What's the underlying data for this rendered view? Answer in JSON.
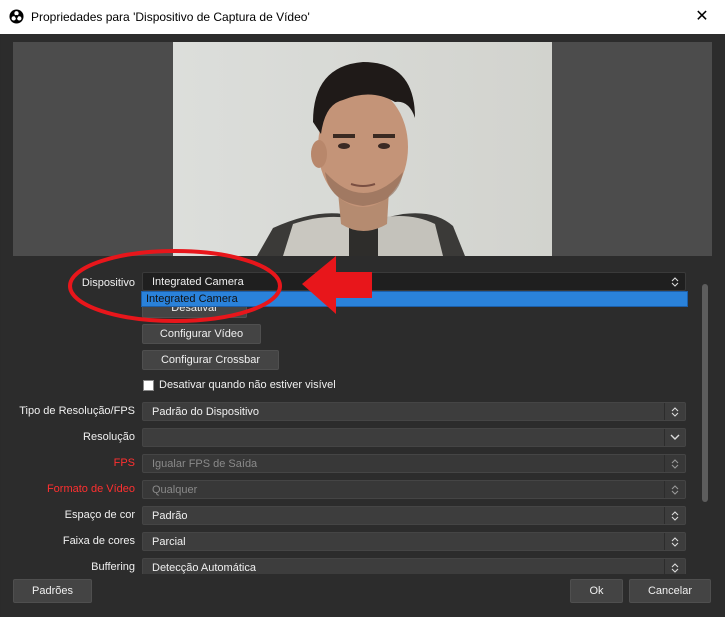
{
  "window": {
    "title": "Propriedades para 'Dispositivo de Captura de Vídeo'",
    "close_glyph": "✕"
  },
  "device": {
    "label": "Dispositivo",
    "value": "Integrated Camera",
    "dropdown_option": "Integrated Camera"
  },
  "buttons": {
    "deactivate": "Desativar",
    "configure_video": "Configurar Vídeo",
    "configure_crossbar": "Configurar Crossbar"
  },
  "checkbox": {
    "label": "Desativar quando não estiver visível",
    "checked": false
  },
  "fields": [
    {
      "label": "Tipo de Resolução/FPS",
      "value": "Padrão do Dispositivo",
      "label_color": "#f0f0f0",
      "disabled": false
    },
    {
      "label": "Resolução",
      "value": "",
      "label_color": "#f0f0f0",
      "disabled": false
    },
    {
      "label": "FPS",
      "value": "Igualar FPS de Saída",
      "label_color": "#ff3030",
      "disabled": true
    },
    {
      "label": "Formato de Vídeo",
      "value": "Qualquer",
      "label_color": "#ff3030",
      "disabled": true
    },
    {
      "label": "Espaço de cor",
      "value": "Padrão",
      "label_color": "#f0f0f0",
      "disabled": false
    },
    {
      "label": "Faixa de cores",
      "value": "Parcial",
      "label_color": "#f0f0f0",
      "disabled": false
    },
    {
      "label": "Buffering",
      "value": "Detecção Automática",
      "label_color": "#f0f0f0",
      "disabled": false
    }
  ],
  "footer": {
    "defaults": "Padrões",
    "ok": "Ok",
    "cancel": "Cancelar"
  },
  "colors": {
    "accent": "#2a82da",
    "annotation": "#e8161b",
    "background": "#2c2c2c"
  },
  "icons": {
    "app": "obs-logo-icon",
    "close": "close-icon",
    "updown": "updown-arrows-icon",
    "chevron": "chevron-down-icon"
  }
}
